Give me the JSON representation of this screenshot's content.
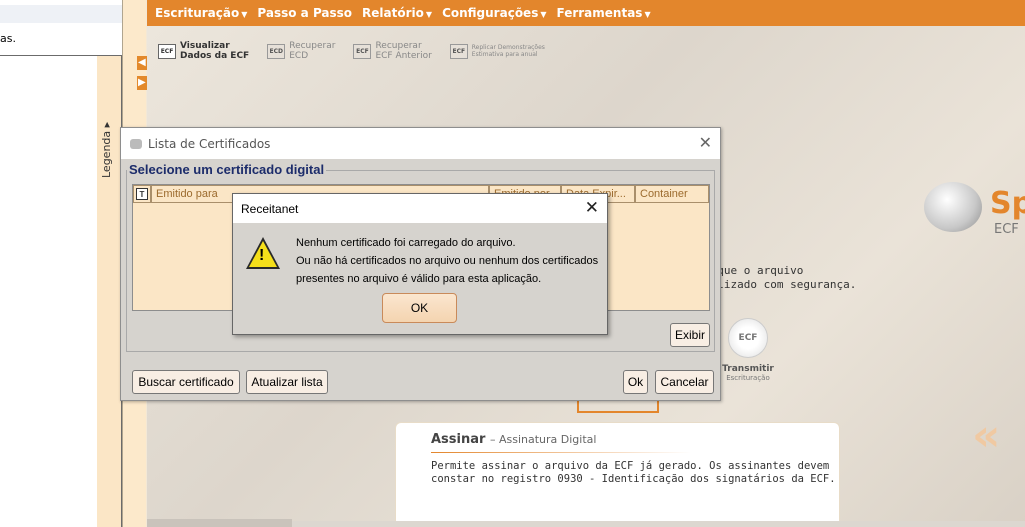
{
  "left_pane": {
    "fragment_text": "as.",
    "legend_label": "Legenda"
  },
  "menu": [
    {
      "label": "Escrituração",
      "has_dropdown": true
    },
    {
      "label": "Passo a Passo",
      "has_dropdown": false
    },
    {
      "label": "Relatório",
      "has_dropdown": true
    },
    {
      "label": "Configurações",
      "has_dropdown": true
    },
    {
      "label": "Ferramentas",
      "has_dropdown": true
    }
  ],
  "toolbar": [
    {
      "icon_label": "ECF",
      "line1": "Visualizar",
      "line2": "Dados da ECF",
      "active": true
    },
    {
      "icon_label": "ECD",
      "line1": "Recuperar",
      "line2": "ECD",
      "active": false
    },
    {
      "icon_label": "ECF",
      "line1": "Recuperar",
      "line2": "ECF Anterior",
      "active": false
    },
    {
      "icon_label": "ECF",
      "line1": "Replicar Demonstrações",
      "line2": "Estimativa para anual",
      "active": false
    }
  ],
  "logo": {
    "text": "Sp",
    "subtitle": "ECF"
  },
  "background_text": {
    "line1": "m que o arquivo",
    "line2": "nalizado com segurança."
  },
  "transmit": {
    "icon_label": "ECF",
    "label": "Transmitir",
    "sublabel": "Escrituração"
  },
  "assinar": {
    "title": "Assinar",
    "subtitle": "– Assinatura Digital",
    "desc_line1": "Permite assinar o arquivo da ECF já gerado. Os assinantes devem",
    "desc_line2": "constar no registro 0930 - Identificação dos signatários da ECF."
  },
  "cert_dialog": {
    "title": "Lista de Certificados",
    "group_label": "Selecione um certificado digital",
    "columns": [
      "T",
      "Emitido para",
      "Emitido por",
      "Data Expir...",
      "Container"
    ],
    "buttons": {
      "exibir": "Exibir",
      "buscar": "Buscar certificado",
      "atualizar": "Atualizar lista",
      "ok": "Ok",
      "cancelar": "Cancelar"
    }
  },
  "alert": {
    "title": "Receitanet",
    "line1": "Nenhum certificado foi carregado do arquivo.",
    "line2": "Ou não há certificados no arquivo ou nenhum dos certificados",
    "line3": "presentes no arquivo é válido para esta aplicação.",
    "ok_label": "OK"
  },
  "colors": {
    "menu_orange": "#e3862c",
    "panel_cream": "#fbe6c6",
    "dialog_gray": "#d6d3ce",
    "group_label_blue": "#1c2c6b"
  }
}
